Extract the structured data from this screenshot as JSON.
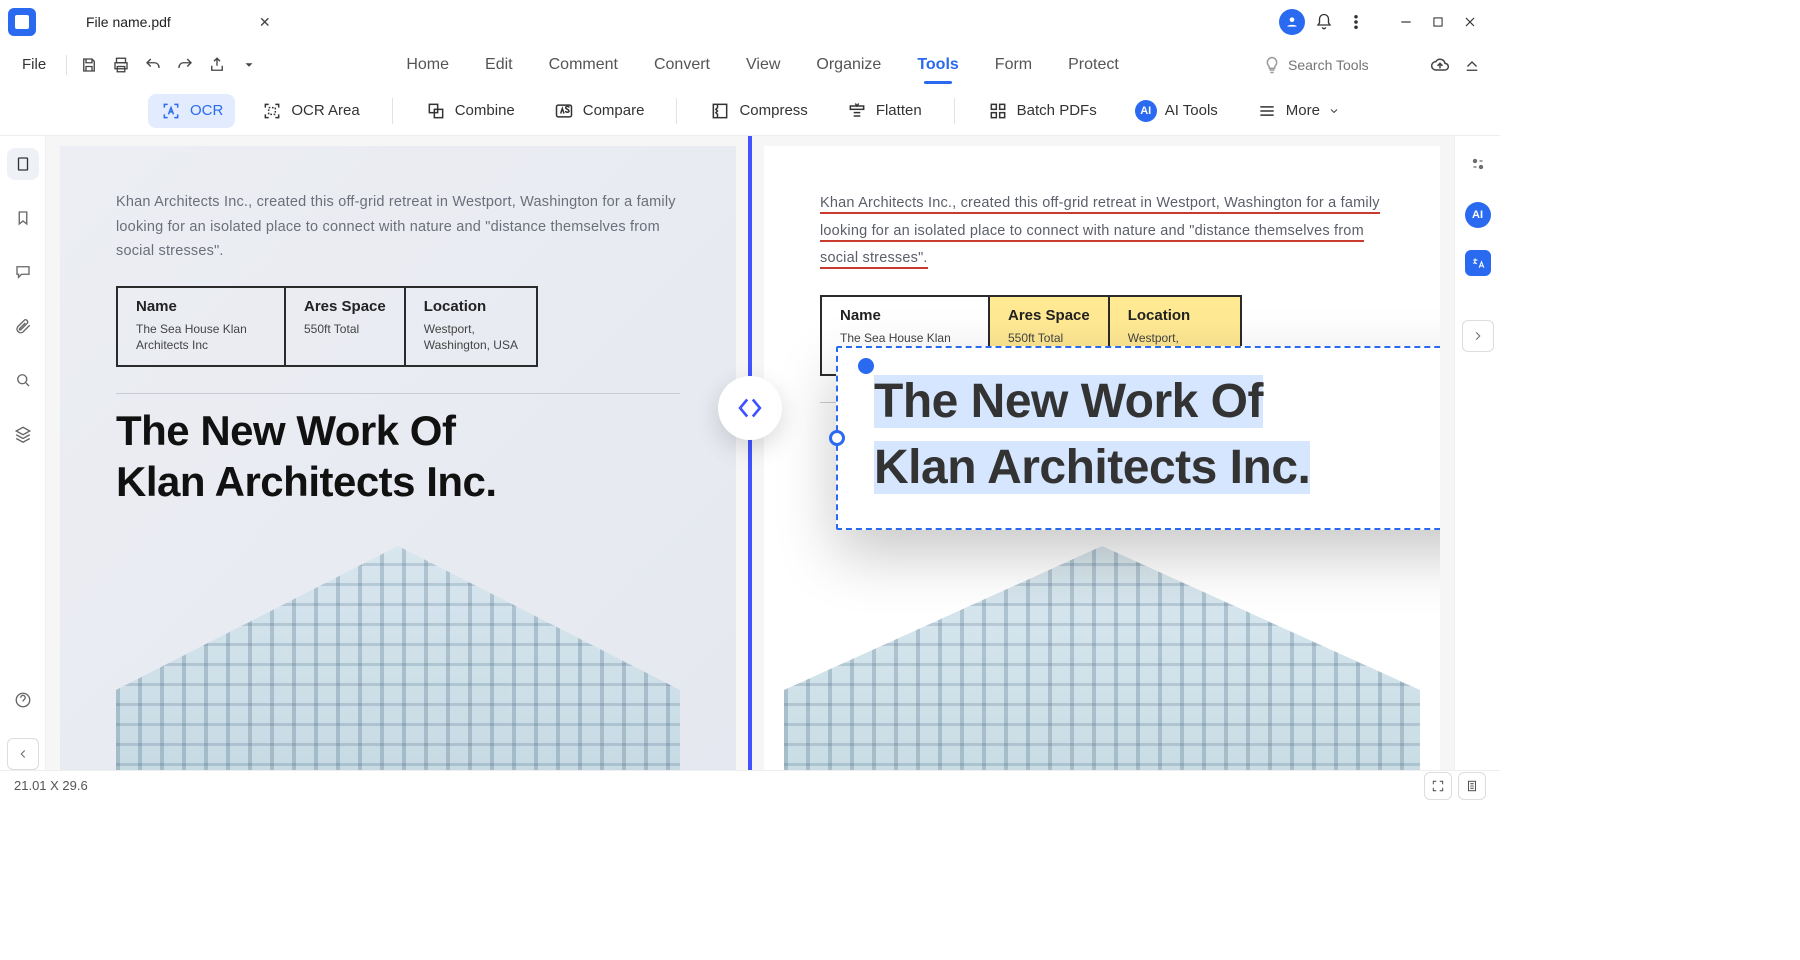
{
  "titlebar": {
    "filename": "File name.pdf"
  },
  "menubar": {
    "file": "File",
    "items": [
      "Home",
      "Edit",
      "Comment",
      "Convert",
      "View",
      "Organize",
      "Tools",
      "Form",
      "Protect"
    ],
    "active_index": 6,
    "search_placeholder": "Search Tools"
  },
  "ribbon": {
    "ocr": "OCR",
    "ocr_area": "OCR Area",
    "combine": "Combine",
    "compare": "Compare",
    "compress": "Compress",
    "flatten": "Flatten",
    "batch": "Batch PDFs",
    "ai_tools": "AI Tools",
    "more": "More"
  },
  "document": {
    "intro": "Khan Architects Inc., created this off-grid retreat in Westport, Washington for a family looking for an isolated place to connect with nature and \"distance themselves from social stresses\".",
    "table": {
      "name": {
        "header": "Name",
        "value": "The Sea House Klan Architects Inc"
      },
      "area": {
        "header": "Ares Space",
        "value": "550ft Total"
      },
      "location": {
        "header": "Location",
        "value": "Westport,\nWashington, USA"
      }
    },
    "hero_line1": "The New Work Of",
    "hero_line2": "Klan Architects Inc."
  },
  "statusbar": {
    "dimensions": "21.01 X 29.6"
  }
}
